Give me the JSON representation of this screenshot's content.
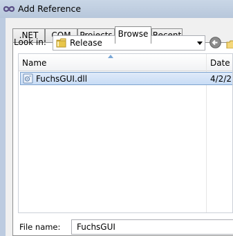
{
  "window": {
    "title": "Add Reference"
  },
  "tabs": [
    {
      "label": ".NET"
    },
    {
      "label": "COM"
    },
    {
      "label": "Projects"
    },
    {
      "label": "Browse",
      "active": true
    },
    {
      "label": "Recent"
    }
  ],
  "lookin": {
    "label": "Look in:",
    "value": "Release"
  },
  "list": {
    "columns": {
      "name": "Name",
      "date": "Date"
    },
    "rows": [
      {
        "name": "FuchsGUI.dll",
        "date": "4/2/2"
      }
    ]
  },
  "filename": {
    "label": "File name:",
    "value": "FuchsGUI"
  },
  "colors": {
    "accent": "#3399ff",
    "selection": "#c8dcf5",
    "folder": "#e9c64a"
  }
}
